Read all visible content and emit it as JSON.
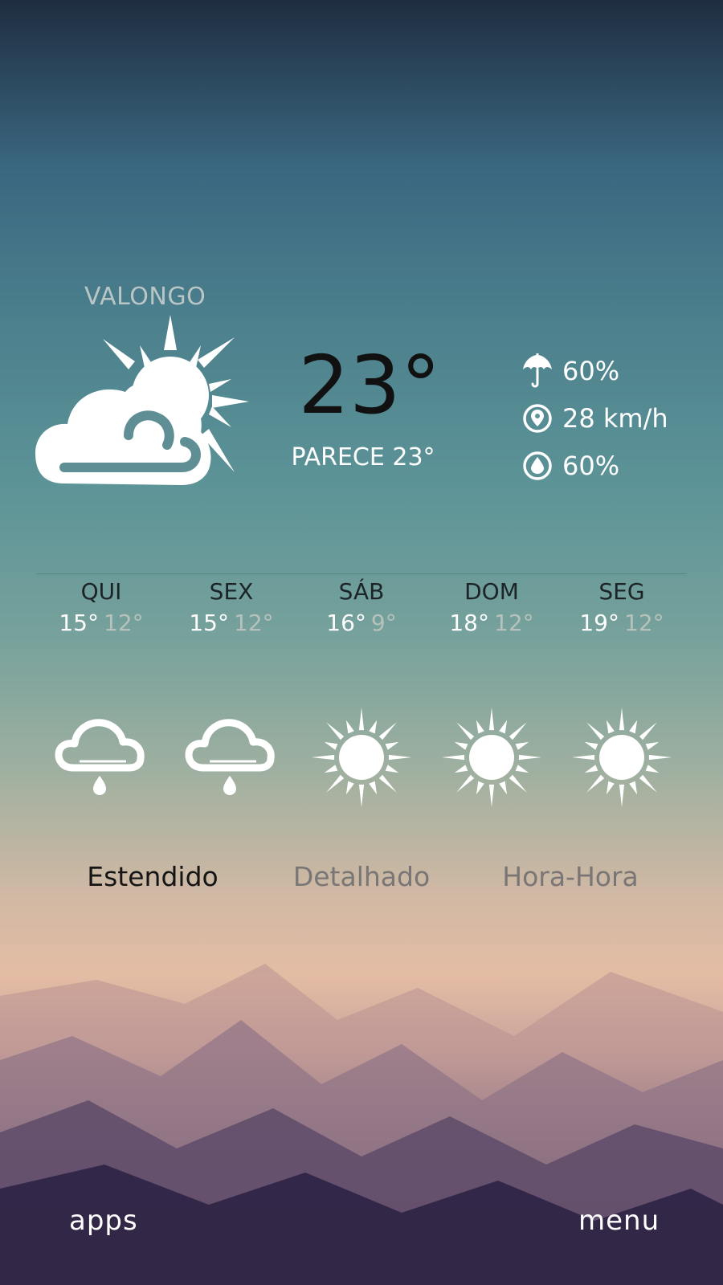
{
  "location": {
    "city": "VALONGO"
  },
  "current": {
    "temperature": "23°",
    "feels_like": "PARECE 23°",
    "condition_icon": "partly-cloudy-icon"
  },
  "stats": {
    "precipitation": {
      "icon": "umbrella-icon",
      "value": "60%"
    },
    "wind": {
      "icon": "wind-icon",
      "value": "28 km/h"
    },
    "humidity": {
      "icon": "humidity-icon",
      "value": "60%"
    }
  },
  "forecast": [
    {
      "day": "QUI",
      "high": "15°",
      "low": "12°",
      "icon": "rain-cloud-icon"
    },
    {
      "day": "SEX",
      "high": "15°",
      "low": "12°",
      "icon": "rain-cloud-icon"
    },
    {
      "day": "SÁB",
      "high": "16°",
      "low": "9°",
      "icon": "sun-icon"
    },
    {
      "day": "DOM",
      "high": "18°",
      "low": "12°",
      "icon": "sun-icon"
    },
    {
      "day": "SEG",
      "high": "19°",
      "low": "12°",
      "icon": "sun-icon"
    }
  ],
  "tabs": {
    "extended": "Estendido",
    "detailed": "Detalhado",
    "hourly": "Hora-Hora"
  },
  "nav": {
    "apps": "apps",
    "menu": "menu"
  }
}
